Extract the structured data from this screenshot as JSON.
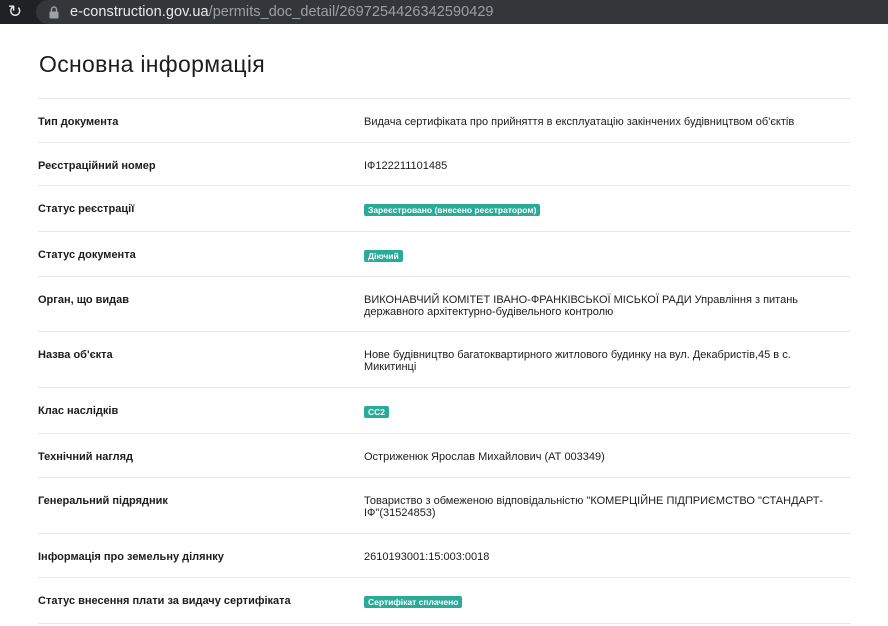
{
  "browser": {
    "url_host": "e-construction.gov.ua",
    "url_path": "/permits_doc_detail/2697254426342590429"
  },
  "page": {
    "title": "Основна інформація"
  },
  "rows": [
    {
      "label": "Тип документа",
      "value": "Видача сертифіката про прийняття в експлуатацію закінчених будівництвом об'єктів"
    },
    {
      "label": "Реєстраційний номер",
      "value": "ІФ122211101485"
    },
    {
      "label": "Статус реєстрації",
      "badge": "Зареєстровано (внесено реєстратором)"
    },
    {
      "label": "Статус документа",
      "badge": "Діючий"
    },
    {
      "label": "Орган, що видав",
      "value": "ВИКОНАВЧИЙ КОМІТЕТ ІВАНО-ФРАНКІВСЬКОЇ МІСЬКОЇ РАДИ Управління з питань державного архітектурно-будівельного контролю"
    },
    {
      "label": "Назва об'єкта",
      "value": "Нове будівництво багатоквартирного житлового будинку на вул. Декабристів,45 в с. Микитинці"
    },
    {
      "label": "Клас наслідків",
      "badge": "СС2"
    },
    {
      "label": "Технічний нагляд",
      "value": "Остриженюк Ярослав Михайлович (АТ 003349)"
    },
    {
      "label": "Генеральний підрядник",
      "value": "Товариство з обмеженою відповідальністю \"КОМЕРЦІЙНЕ ПІДПРИЄМСТВО \"СТАНДАРТ-ІФ\"(31524853)"
    },
    {
      "label": "Інформація про земельну ділянку",
      "value": "2610193001:15:003:0018"
    },
    {
      "label": "Статус внесення плати за видачу сертифіката",
      "badge": "Сертифікат сплачено"
    }
  ],
  "colors": {
    "badge": "#2aab9a",
    "browser_bar": "#202124"
  }
}
